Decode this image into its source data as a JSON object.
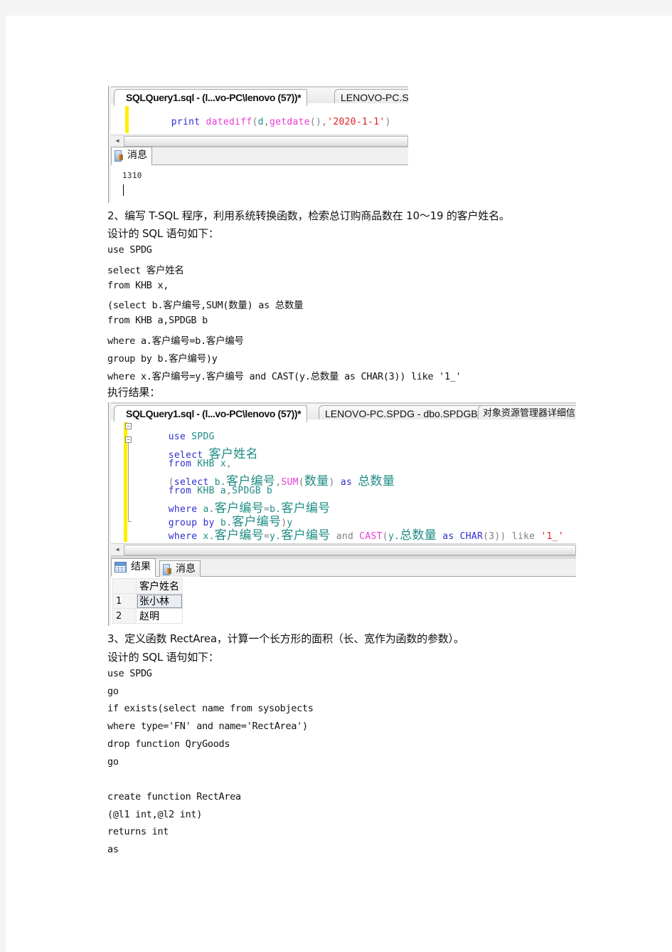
{
  "screenshot1": {
    "tabs": [
      {
        "label": "SQLQuery1.sql - (l...vo-PC\\lenovo (57))*",
        "active": true
      },
      {
        "label": "LENOVO-PC.S",
        "active": false
      }
    ],
    "code": {
      "kw_print": "print",
      "fn_datediff": "datediff",
      "paren_open": "(",
      "arg_d": "d",
      "comma1": ",",
      "fn_getdate": "getdate",
      "parens": "()",
      "comma2": ",",
      "str_date": "'2020-1-1'",
      "paren_close": ")"
    },
    "results_tabs": [
      {
        "label": "消息",
        "icon": "messages-icon"
      }
    ],
    "output": "1310"
  },
  "section2": {
    "heading": "2、编写 T-SQL 程序，利用系统转换函数，检索总订购商品数在 10～19 的客户姓名。",
    "intro": "设计的 SQL 语句如下：",
    "lines": [
      "use SPDG",
      "select 客户姓名",
      "from KHB x,",
      "(select b.客户编号,SUM(数量) as 总数量",
      "from KHB a,SPDGB b",
      "where a.客户编号=b.客户编号",
      "group by b.客户编号)y",
      "where x.客户编号=y.客户编号 and CAST(y.总数量 as CHAR(3)) like '1_'"
    ],
    "result_label": "执行结果："
  },
  "screenshot2": {
    "tabs": [
      {
        "label": "SQLQuery1.sql - (l...vo-PC\\lenovo (57))*",
        "active": true
      },
      {
        "label": "LENOVO-PC.SPDG - dbo.SPDGB",
        "active": false
      },
      {
        "label": "对象资源管理器详细信",
        "active": false
      }
    ],
    "code": {
      "l1": {
        "kw": "use",
        "id": " SPDG"
      },
      "l2": {
        "kw": "select",
        "cjk": "客户姓名"
      },
      "l3": {
        "kw": "from",
        "id": " KHB x",
        "p": ","
      },
      "l4": {
        "p1": "(",
        "kw1": "select",
        "id1": " b.",
        "cjk1": "客户编号",
        "p2": ",",
        "fn": "SUM",
        "p3": "(",
        "cjk2": "数量",
        "p4": ")",
        "kw2": "as",
        "cjk3": "总数量"
      },
      "l5": {
        "kw": "from",
        "id": " KHB a",
        "p": ",",
        "id2": "SPDGB b"
      },
      "l6": {
        "kw": "where",
        "id1": " a.",
        "cjk1": "客户编号",
        "p": "=",
        "id2": "b.",
        "cjk2": "客户编号"
      },
      "l7": {
        "kw1": "group",
        "kw2": "by",
        "id1": " b.",
        "cjk1": "客户编号",
        "p": ")",
        "id2": "y"
      },
      "l8": {
        "kw": "where",
        "id1": " x.",
        "cjk1": "客户编号",
        "p": "=",
        "id2": "y.",
        "cjk2": "客户编号",
        "and": "and",
        "fn": "CAST",
        "p1": "(",
        "id3": "y.",
        "cjk3": "总数量",
        "kw2": "as",
        "kw3": "CHAR",
        "p2": "(3))",
        "like": "like",
        "str": "'1_'"
      }
    },
    "results_tabs": [
      {
        "label": "结果",
        "icon": "grid-icon",
        "active": true
      },
      {
        "label": "消息",
        "icon": "messages-icon",
        "active": false
      }
    ],
    "grid": {
      "columns": [
        "客户姓名"
      ],
      "rows": [
        {
          "n": "1",
          "name": "张小林"
        },
        {
          "n": "2",
          "name": "赵明"
        }
      ]
    }
  },
  "section3": {
    "heading": "3、定义函数 RectArea，计算一个长方形的面积（长、宽作为函数的参数）。",
    "intro": "设计的 SQL 语句如下：",
    "lines": [
      "use SPDG",
      "go",
      "if exists(select name from sysobjects",
      "where type='FN' and name='RectArea')",
      "drop function QryGoods",
      "go",
      "",
      "create function RectArea",
      "(@l1 int,@l2 int)",
      "returns int",
      "as"
    ]
  },
  "colors": {
    "keyword": "#2f2fd0",
    "function": "#e83ad6",
    "string": "#e02020",
    "identifier": "#1e8c84",
    "operator": "#808080",
    "changed_line_marker": "#ffee00",
    "page_background": "#f4f4f4"
  }
}
